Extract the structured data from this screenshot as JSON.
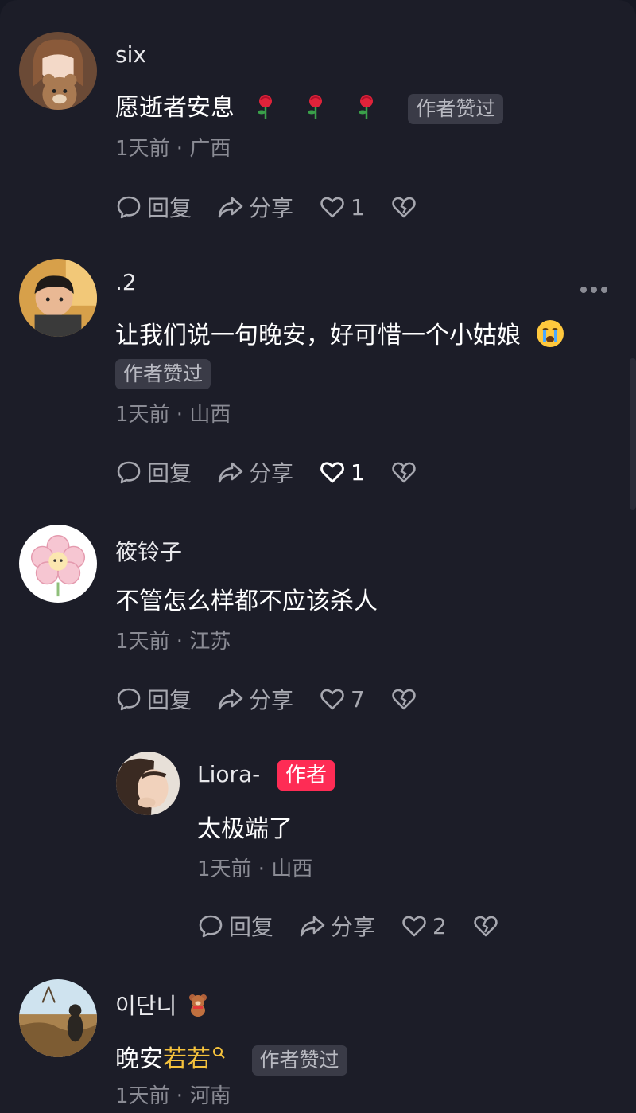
{
  "comments": [
    {
      "username": "six",
      "text": "愿逝者安息",
      "badge": "作者赞过",
      "time_location": "1天前 · 广西",
      "reply_label": "回复",
      "share_label": "分享",
      "likes": "1",
      "emojis": [
        "rose-emoji",
        "rose-emoji",
        "rose-emoji"
      ]
    },
    {
      "username": ".2",
      "text": "让我们说一句晚安，好可惜一个小姑娘",
      "badge": "作者赞过",
      "time_location": "1天前 · 山西",
      "reply_label": "回复",
      "share_label": "分享",
      "likes": "1",
      "emojis": [
        "crying-emoji"
      ]
    },
    {
      "username": "筱铃子",
      "text": "不管怎么样都不应该杀人",
      "time_location": "1天前 · 江苏",
      "reply_label": "回复",
      "share_label": "分享",
      "likes": "7"
    },
    {
      "username": "Liora-",
      "author_tag": "作者",
      "text": "太极端了",
      "time_location": "1天前 · 山西",
      "reply_label": "回复",
      "share_label": "分享",
      "likes": "2",
      "is_reply": true
    },
    {
      "username": "이단니",
      "username_emoji": "teddy-bear-emoji",
      "text_prefix": "晚安",
      "text_highlight": "若若",
      "badge": "作者赞过",
      "time_location": "1天前 · 河南"
    }
  ],
  "colors": {
    "background": "#1c1d28",
    "author_tag": "#fe2c55",
    "highlight": "#f5c23c",
    "meta_text": "#8a8b94"
  }
}
